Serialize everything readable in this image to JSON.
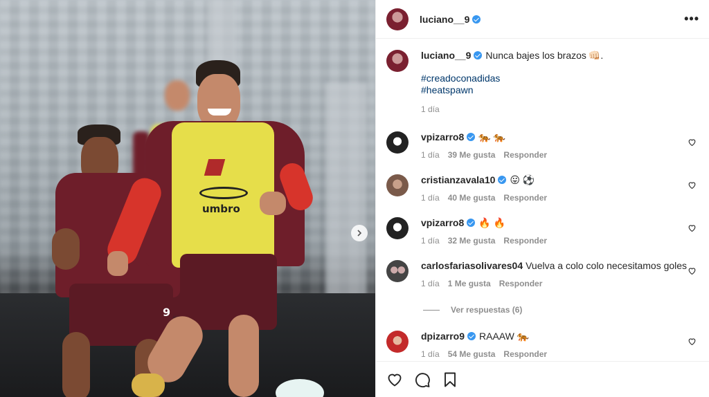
{
  "post": {
    "username": "luciano__9",
    "more_icon": "more-horizontal-icon"
  },
  "caption": {
    "username": "luciano__9",
    "text": "Nunca bajes los brazos",
    "emoji": "👊🏻.",
    "tags": [
      "#creadoconadidas",
      "#heatspawn"
    ],
    "time": "1 día"
  },
  "comments": [
    {
      "username": "vpizarro8",
      "text": "🐅 🐅",
      "time": "1 día",
      "likes": "39 Me gusta",
      "reply": "Responder",
      "avatar_color": "#222222"
    },
    {
      "username": "cristianzavala10",
      "text": "😛 ⚽",
      "time": "1 día",
      "likes": "40 Me gusta",
      "reply": "Responder",
      "avatar_color": "#7a5a4a"
    },
    {
      "username": "vpizarro8",
      "text": "🔥 🔥",
      "time": "1 día",
      "likes": "32 Me gusta",
      "reply": "Responder",
      "avatar_color": "#222222"
    },
    {
      "username": "carlosfariasolivares04",
      "text": "Vuelva a colo colo necesitamos goles",
      "time": "1 día",
      "likes": "1 Me gusta",
      "reply": "Responder",
      "avatar_color": "#4a4a4a"
    },
    {
      "username": "dpizarro9",
      "text": "RAAAW 🐅",
      "time": "1 día",
      "likes": "54 Me gusta",
      "reply": "Responder",
      "avatar_color": "#c32a2a"
    }
  ],
  "view_replies": "Ver respuestas (6)",
  "colors": {
    "link": "#00376b",
    "verified": "#3897f0",
    "muted": "#8e8e8e",
    "text": "#262626"
  },
  "icons": {
    "like": "heart-icon",
    "comment": "comment-icon",
    "save": "bookmark-icon",
    "next": "chevron-right-icon"
  }
}
